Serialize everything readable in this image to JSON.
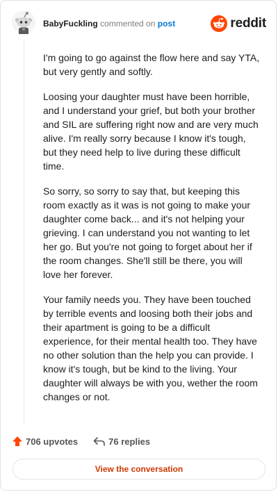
{
  "header": {
    "username": "BabyFuckling",
    "action": "commented on",
    "link": "post",
    "brand": "reddit"
  },
  "comment": {
    "paragraphs": [
      "I'm going to go against the flow here and say YTA, but very gently and softly.",
      "Loosing your daughter must have been horrible, and I understand your grief, but both your brother and SIL are suffering right now and are very much alive. I'm really sorry because I know it's tough, but they need help to live during these difficult time.",
      "So sorry, so sorry to say that, but keeping this room exactly as it was is not going to make your daughter come back... and it's not helping your grieving. I can understand you not wanting to let her go. But you're not going to forget about her if the room changes. She'll still be there, you will love her forever.",
      "Your family needs you. They have been touched by terrible events and loosing both their jobs and their apartment is going to be a difficult experience, for their mental health too. They have no other solution than the help you can provide. I know it's tough, but be kind to the living. Your daughter will always be with you, wether the room changes or not."
    ]
  },
  "footer": {
    "upvotes": "706 upvotes",
    "replies": "76 replies",
    "button_label": "View the conversation"
  },
  "colors": {
    "reddit_orange": "#ff4500",
    "link_blue": "#0079d3",
    "button_text": "#cc3700"
  },
  "icons": {
    "avatar": "snoo-avatar",
    "brand": "reddit-logo-icon",
    "upvote": "upvote-arrow-icon",
    "reply": "reply-arrow-icon"
  }
}
